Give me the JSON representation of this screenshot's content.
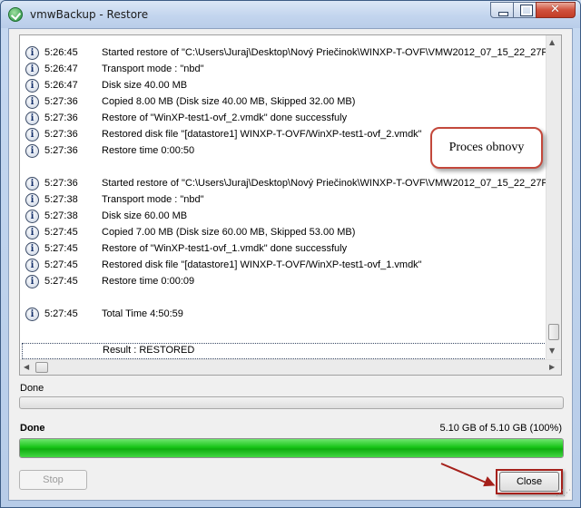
{
  "window": {
    "title": "vmwBackup - Restore",
    "minimize_glyph": "",
    "maximize_glyph": "",
    "close_glyph": "✕"
  },
  "log": {
    "rows": [
      {
        "time": "5:26:45",
        "message": "Started restore of \"C:\\Users\\Juraj\\Desktop\\Nový Priečinok\\WINXP-T-OVF\\VMW2012_07_15_22_27F"
      },
      {
        "time": "5:26:47",
        "message": "Transport mode : \"nbd\""
      },
      {
        "time": "5:26:47",
        "message": "Disk size 40.00 MB"
      },
      {
        "time": "5:27:36",
        "message": "Copied 8.00 MB (Disk size 40.00 MB, Skipped 32.00 MB)"
      },
      {
        "time": "5:27:36",
        "message": "Restore of \"WinXP-test1-ovf_2.vmdk\" done successfuly"
      },
      {
        "time": "5:27:36",
        "message": "Restored disk file \"[datastore1] WINXP-T-OVF/WinXP-test1-ovf_2.vmdk\""
      },
      {
        "time": "5:27:36",
        "message": "Restore time 0:00:50"
      },
      {
        "time": "5:27:36",
        "message": "Started restore of \"C:\\Users\\Juraj\\Desktop\\Nový Priečinok\\WINXP-T-OVF\\VMW2012_07_15_22_27F"
      },
      {
        "time": "5:27:38",
        "message": "Transport mode : \"nbd\""
      },
      {
        "time": "5:27:38",
        "message": "Disk size 60.00 MB"
      },
      {
        "time": "5:27:45",
        "message": "Copied 7.00 MB (Disk size 60.00 MB, Skipped 53.00 MB)"
      },
      {
        "time": "5:27:45",
        "message": "Restore of \"WinXP-test1-ovf_1.vmdk\" done successfuly"
      },
      {
        "time": "5:27:45",
        "message": "Restored disk file \"[datastore1] WINXP-T-OVF/WinXP-test1-ovf_1.vmdk\""
      },
      {
        "time": "5:27:45",
        "message": "Restore time 0:00:09"
      },
      {
        "time": "5:27:45",
        "message": "Total Time 4:50:59"
      }
    ],
    "result": "Result : RESTORED",
    "info_icon_glyph": "i",
    "scroll_up": "▲",
    "scroll_down": "▼",
    "scroll_left": "◀",
    "scroll_right": "▶"
  },
  "callout": {
    "text": "Proces obnovy"
  },
  "status": {
    "label": "Done",
    "overall_label": "Done",
    "size_text": "5.10 GB of 5.10 GB (100%)",
    "progress_fraction": 1.0
  },
  "buttons": {
    "stop": "Stop",
    "close": "Close"
  },
  "colors": {
    "progress_green": "#18c418",
    "annotation_red": "#a5201a"
  },
  "icons": {
    "app": "app-check-icon",
    "row": "info-icon",
    "grip": "resize-grip-icon"
  }
}
